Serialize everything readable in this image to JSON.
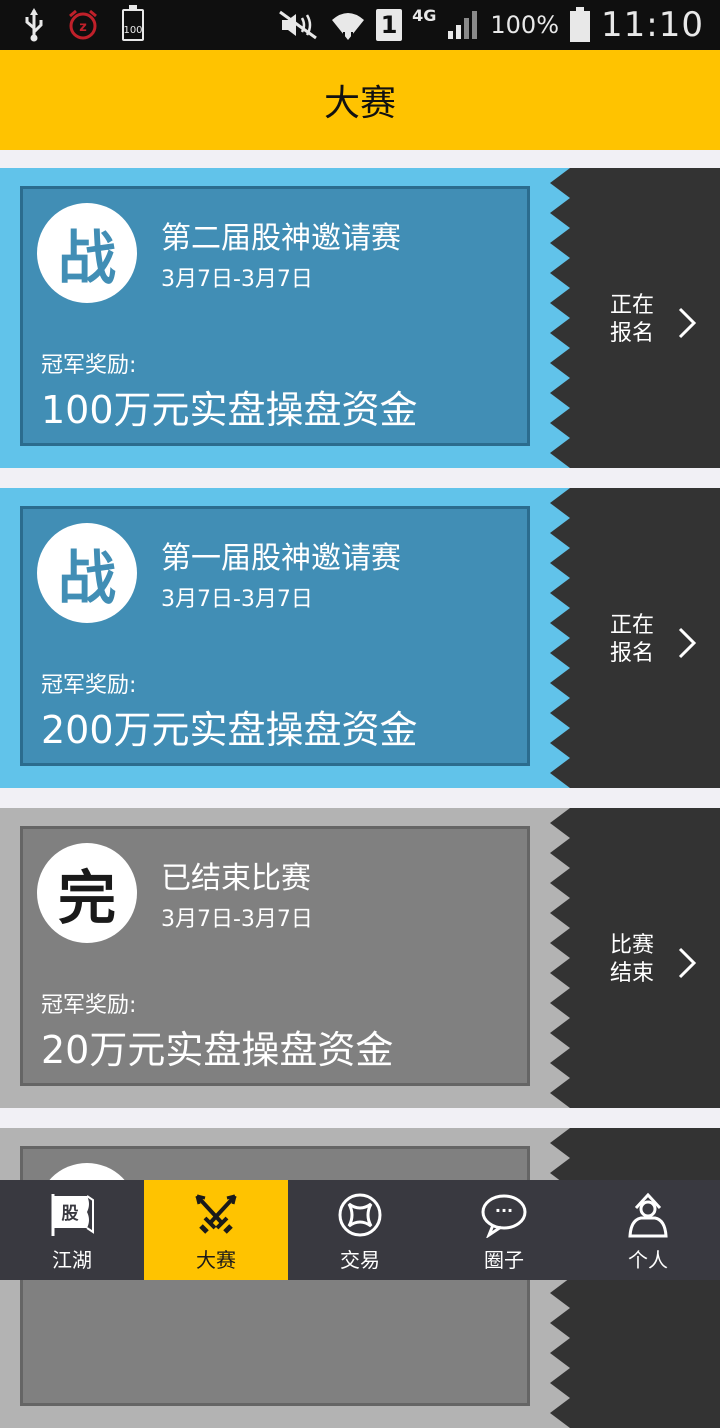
{
  "status_bar": {
    "battery_box": "100",
    "box1": "1",
    "network": "4G",
    "battery_pct": "100%",
    "time": "11:10"
  },
  "header": {
    "title": "大赛"
  },
  "contests": [
    {
      "badge": "战",
      "title": "第二届股神邀请赛",
      "dates": "3月7日-3月7日",
      "prize_label": "冠军奖励:",
      "prize": "100万元实盘操盘资金",
      "status_line1": "正在",
      "status_line2": "报名",
      "state": "active"
    },
    {
      "badge": "战",
      "title": "第一届股神邀请赛",
      "dates": "3月7日-3月7日",
      "prize_label": "冠军奖励:",
      "prize": "200万元实盘操盘资金",
      "status_line1": "正在",
      "status_line2": "报名",
      "state": "active"
    },
    {
      "badge": "完",
      "title": "已结束比赛",
      "dates": "3月7日-3月7日",
      "prize_label": "冠军奖励:",
      "prize": "20万元实盘操盘资金",
      "status_line1": "比赛",
      "status_line2": "结束",
      "state": "ended"
    },
    {
      "state": "ended"
    }
  ],
  "nav": {
    "items": [
      {
        "label": "江湖",
        "icon": "flag-icon",
        "icon_text": "股"
      },
      {
        "label": "大赛",
        "icon": "crossed-swords-icon"
      },
      {
        "label": "交易",
        "icon": "trade-icon"
      },
      {
        "label": "圈子",
        "icon": "chat-bubble-icon",
        "icon_text": "···"
      },
      {
        "label": "个人",
        "icon": "person-icon"
      }
    ],
    "active_index": 1
  },
  "colors": {
    "header": "#ffc300",
    "active_outer": "#61c3ea",
    "active_inner": "#418eb5",
    "ended_outer": "#b3b3b3",
    "ended_inner": "#808080",
    "side_panel": "#333333",
    "nav_bg": "#393940"
  }
}
